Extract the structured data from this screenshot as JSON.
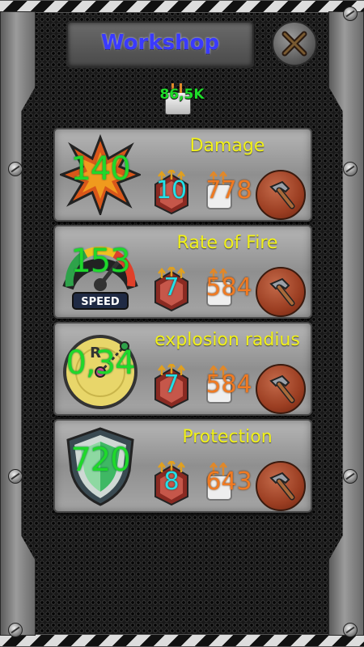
{
  "header": {
    "title": "Workshop",
    "currency_value": "86,5K"
  },
  "upgrades": [
    {
      "name": "Damage",
      "stat_value": "140",
      "level": "10",
      "cost": "778",
      "icon": "explosion-icon"
    },
    {
      "name": "Rate of Fire",
      "stat_value": "153",
      "level": "7",
      "cost": "584",
      "icon": "speedometer-icon",
      "icon_label": "SPEED"
    },
    {
      "name": "explosion radius",
      "stat_value": "0,34",
      "level": "7",
      "cost": "584",
      "icon": "radius-icon",
      "icon_label": "R"
    },
    {
      "name": "Protection",
      "stat_value": "720",
      "level": "8",
      "cost": "643",
      "icon": "shield-icon"
    }
  ],
  "colors": {
    "title_text": "#3a3aff",
    "stat_text": "#1fd82b",
    "name_text": "#f1f11a",
    "level_text": "#23e0e8",
    "cost_text": "#f07a22",
    "upgrade_button": "#9b3e22"
  }
}
